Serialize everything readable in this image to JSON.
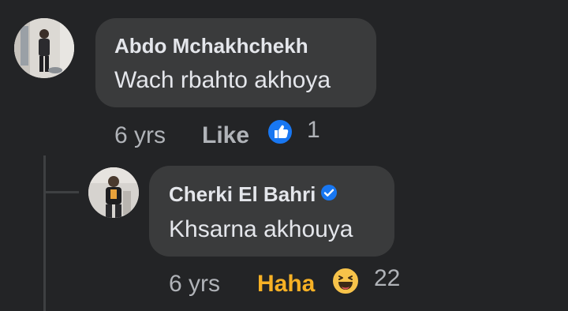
{
  "comments": [
    {
      "author": "Abdo Mchakhchekh",
      "text": "Wach rbahto akhoya",
      "time": "6 yrs",
      "action": "Like",
      "reaction_icon": "like-reaction-icon",
      "reaction_count": "1"
    },
    {
      "author": "Cherki El Bahri",
      "verified_icon": "verified-badge-icon",
      "text": "Khsarna akhouya",
      "time": "6 yrs",
      "action": "Haha",
      "action_color": "#f7b125",
      "reaction_icon": "haha-reaction-icon",
      "reaction_count": "22"
    }
  ],
  "colors": {
    "background": "#232426",
    "bubble": "#3a3b3c",
    "text": "#e4e6eb",
    "secondary": "#b0b3b8",
    "like_blue": "#1877f2"
  }
}
